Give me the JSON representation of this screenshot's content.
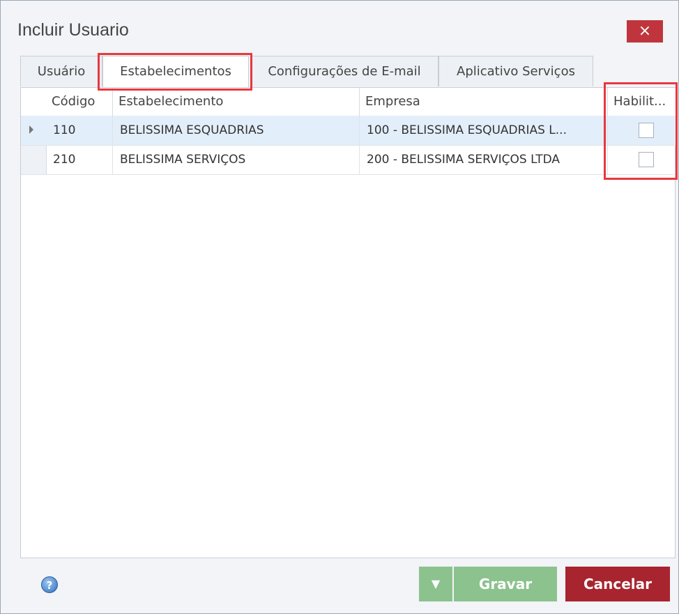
{
  "window": {
    "title": "Incluir Usuario",
    "close_label": "×"
  },
  "tabs": [
    {
      "label": "Usuário",
      "active": false
    },
    {
      "label": "Estabelecimentos",
      "active": true
    },
    {
      "label": "Configurações de E-mail",
      "active": false
    },
    {
      "label": "Aplicativo Serviços",
      "active": false
    }
  ],
  "grid": {
    "columns": [
      "Código",
      "Estabelecimento",
      "Empresa",
      "Habilit..."
    ],
    "rows": [
      {
        "codigo": "110",
        "estabelecimento": "BELISSIMA ESQUADRIAS",
        "empresa": "100 - BELISSIMA ESQUADRIAS L...",
        "habilitado": false,
        "selected": true
      },
      {
        "codigo": "210",
        "estabelecimento": "BELISSIMA SERVIÇOS",
        "empresa": "200 - BELISSIMA SERVIÇOS LTDA",
        "habilitado": false,
        "selected": false
      }
    ]
  },
  "footer": {
    "help_icon": "?",
    "dropdown_icon": "▼",
    "save_label": "Gravar",
    "cancel_label": "Cancelar"
  },
  "colors": {
    "highlight": "#e8383f",
    "save_button": "#8cc28e",
    "cancel_button": "#a8242e",
    "close_button": "#c0353d"
  }
}
